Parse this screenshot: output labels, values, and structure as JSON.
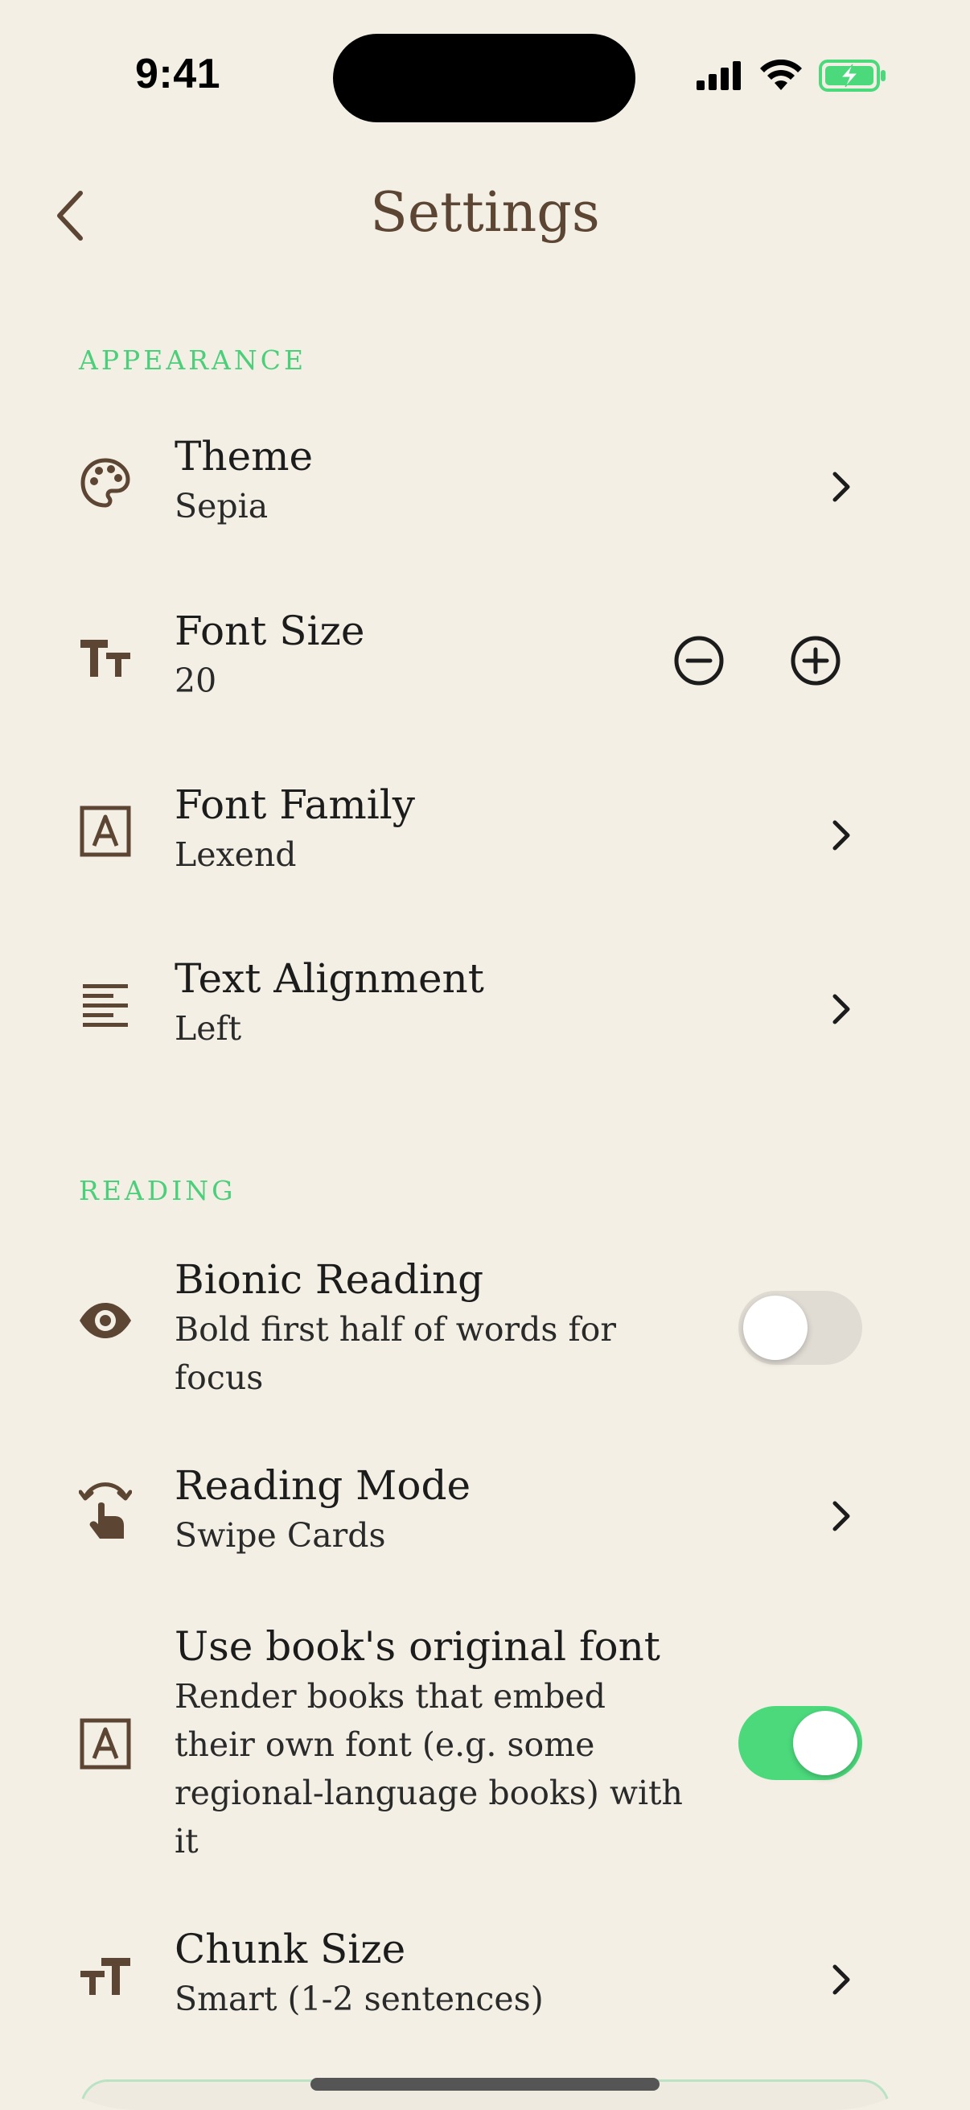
{
  "status_bar": {
    "time": "9:41"
  },
  "header": {
    "title": "Settings",
    "back_icon": "chevron-left-icon"
  },
  "sections": {
    "appearance": {
      "label": "APPEARANCE",
      "theme": {
        "title": "Theme",
        "value": "Sepia",
        "icon": "palette-icon"
      },
      "font_size": {
        "title": "Font Size",
        "value": "20",
        "icon": "text-size-icon"
      },
      "font_family": {
        "title": "Font Family",
        "value": "Lexend",
        "icon": "font-a-icon"
      },
      "text_alignment": {
        "title": "Text Alignment",
        "value": "Left",
        "icon": "align-left-icon"
      }
    },
    "reading": {
      "label": "READING",
      "bionic": {
        "title": "Bionic Reading",
        "subtitle": "Bold first half of words for focus",
        "enabled": false,
        "icon": "eye-icon"
      },
      "reading_mode": {
        "title": "Reading Mode",
        "value": "Swipe Cards",
        "icon": "swipe-hand-icon"
      },
      "original_font": {
        "title": "Use book's original font",
        "subtitle": "Render books that embed their own font (e.g. some regional-language books) with it",
        "enabled": true,
        "icon": "font-a-icon"
      },
      "chunk_size": {
        "title": "Chunk Size",
        "value": "Smart (1-2 sentences)",
        "icon": "text-size-icon"
      }
    }
  },
  "colors": {
    "background": "#f3efe5",
    "accent": "#4cd97c",
    "brown": "#5c4532"
  }
}
